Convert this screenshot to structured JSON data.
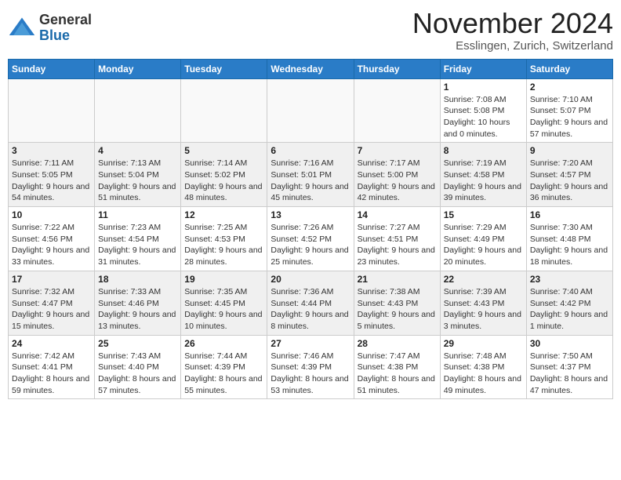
{
  "header": {
    "logo_general": "General",
    "logo_blue": "Blue",
    "title": "November 2024",
    "location": "Esslingen, Zurich, Switzerland"
  },
  "weekdays": [
    "Sunday",
    "Monday",
    "Tuesday",
    "Wednesday",
    "Thursday",
    "Friday",
    "Saturday"
  ],
  "weeks": [
    [
      {
        "day": "",
        "empty": true
      },
      {
        "day": "",
        "empty": true
      },
      {
        "day": "",
        "empty": true
      },
      {
        "day": "",
        "empty": true
      },
      {
        "day": "",
        "empty": true
      },
      {
        "day": "1",
        "sunrise": "7:08 AM",
        "sunset": "5:08 PM",
        "daylight": "10 hours and 0 minutes."
      },
      {
        "day": "2",
        "sunrise": "7:10 AM",
        "sunset": "5:07 PM",
        "daylight": "9 hours and 57 minutes."
      }
    ],
    [
      {
        "day": "3",
        "sunrise": "7:11 AM",
        "sunset": "5:05 PM",
        "daylight": "9 hours and 54 minutes."
      },
      {
        "day": "4",
        "sunrise": "7:13 AM",
        "sunset": "5:04 PM",
        "daylight": "9 hours and 51 minutes."
      },
      {
        "day": "5",
        "sunrise": "7:14 AM",
        "sunset": "5:02 PM",
        "daylight": "9 hours and 48 minutes."
      },
      {
        "day": "6",
        "sunrise": "7:16 AM",
        "sunset": "5:01 PM",
        "daylight": "9 hours and 45 minutes."
      },
      {
        "day": "7",
        "sunrise": "7:17 AM",
        "sunset": "5:00 PM",
        "daylight": "9 hours and 42 minutes."
      },
      {
        "day": "8",
        "sunrise": "7:19 AM",
        "sunset": "4:58 PM",
        "daylight": "9 hours and 39 minutes."
      },
      {
        "day": "9",
        "sunrise": "7:20 AM",
        "sunset": "4:57 PM",
        "daylight": "9 hours and 36 minutes."
      }
    ],
    [
      {
        "day": "10",
        "sunrise": "7:22 AM",
        "sunset": "4:56 PM",
        "daylight": "9 hours and 33 minutes."
      },
      {
        "day": "11",
        "sunrise": "7:23 AM",
        "sunset": "4:54 PM",
        "daylight": "9 hours and 31 minutes."
      },
      {
        "day": "12",
        "sunrise": "7:25 AM",
        "sunset": "4:53 PM",
        "daylight": "9 hours and 28 minutes."
      },
      {
        "day": "13",
        "sunrise": "7:26 AM",
        "sunset": "4:52 PM",
        "daylight": "9 hours and 25 minutes."
      },
      {
        "day": "14",
        "sunrise": "7:27 AM",
        "sunset": "4:51 PM",
        "daylight": "9 hours and 23 minutes."
      },
      {
        "day": "15",
        "sunrise": "7:29 AM",
        "sunset": "4:49 PM",
        "daylight": "9 hours and 20 minutes."
      },
      {
        "day": "16",
        "sunrise": "7:30 AM",
        "sunset": "4:48 PM",
        "daylight": "9 hours and 18 minutes."
      }
    ],
    [
      {
        "day": "17",
        "sunrise": "7:32 AM",
        "sunset": "4:47 PM",
        "daylight": "9 hours and 15 minutes."
      },
      {
        "day": "18",
        "sunrise": "7:33 AM",
        "sunset": "4:46 PM",
        "daylight": "9 hours and 13 minutes."
      },
      {
        "day": "19",
        "sunrise": "7:35 AM",
        "sunset": "4:45 PM",
        "daylight": "9 hours and 10 minutes."
      },
      {
        "day": "20",
        "sunrise": "7:36 AM",
        "sunset": "4:44 PM",
        "daylight": "9 hours and 8 minutes."
      },
      {
        "day": "21",
        "sunrise": "7:38 AM",
        "sunset": "4:43 PM",
        "daylight": "9 hours and 5 minutes."
      },
      {
        "day": "22",
        "sunrise": "7:39 AM",
        "sunset": "4:43 PM",
        "daylight": "9 hours and 3 minutes."
      },
      {
        "day": "23",
        "sunrise": "7:40 AM",
        "sunset": "4:42 PM",
        "daylight": "9 hours and 1 minute."
      }
    ],
    [
      {
        "day": "24",
        "sunrise": "7:42 AM",
        "sunset": "4:41 PM",
        "daylight": "8 hours and 59 minutes."
      },
      {
        "day": "25",
        "sunrise": "7:43 AM",
        "sunset": "4:40 PM",
        "daylight": "8 hours and 57 minutes."
      },
      {
        "day": "26",
        "sunrise": "7:44 AM",
        "sunset": "4:39 PM",
        "daylight": "8 hours and 55 minutes."
      },
      {
        "day": "27",
        "sunrise": "7:46 AM",
        "sunset": "4:39 PM",
        "daylight": "8 hours and 53 minutes."
      },
      {
        "day": "28",
        "sunrise": "7:47 AM",
        "sunset": "4:38 PM",
        "daylight": "8 hours and 51 minutes."
      },
      {
        "day": "29",
        "sunrise": "7:48 AM",
        "sunset": "4:38 PM",
        "daylight": "8 hours and 49 minutes."
      },
      {
        "day": "30",
        "sunrise": "7:50 AM",
        "sunset": "4:37 PM",
        "daylight": "8 hours and 47 minutes."
      }
    ]
  ],
  "labels": {
    "sunrise": "Sunrise:",
    "sunset": "Sunset:",
    "daylight": "Daylight:"
  }
}
